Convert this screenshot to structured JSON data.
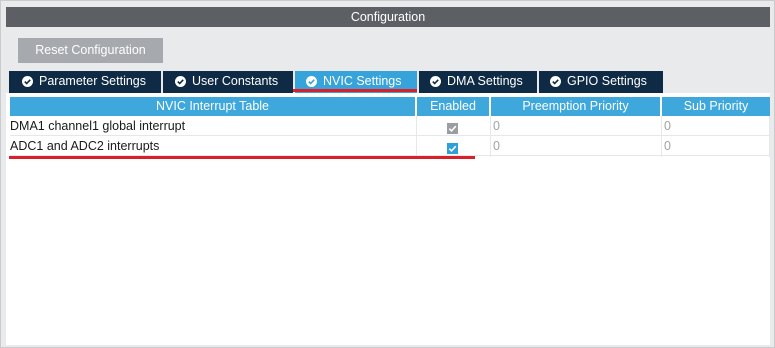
{
  "window": {
    "title": "Configuration"
  },
  "toolbar": {
    "reset_label": "Reset Configuration"
  },
  "tabs": [
    {
      "label": "Parameter Settings",
      "active": false
    },
    {
      "label": "User Constants",
      "active": false
    },
    {
      "label": "NVIC Settings",
      "active": true
    },
    {
      "label": "DMA Settings",
      "active": false
    },
    {
      "label": "GPIO Settings",
      "active": false
    }
  ],
  "table": {
    "headers": [
      "NVIC Interrupt Table",
      "Enabled",
      "Preemption Priority",
      "Sub Priority"
    ],
    "rows": [
      {
        "name": "DMA1 channel1 global interrupt",
        "enabled": true,
        "enabled_locked": true,
        "preemption": "0",
        "sub": "0"
      },
      {
        "name": "ADC1 and ADC2 interrupts",
        "enabled": true,
        "enabled_locked": false,
        "preemption": "0",
        "sub": "0"
      }
    ]
  },
  "colors": {
    "tab_inactive": "#0f2a45",
    "tab_active": "#36a3da",
    "header": "#3ea7dc",
    "annotation_red": "#d8202a",
    "checkbox_enabled": "#2e9fd9",
    "checkbox_locked": "#9b9ea1"
  },
  "icons": {
    "tab_icon": "check-circle-icon",
    "checkbox_icon": "checkmark-icon"
  }
}
